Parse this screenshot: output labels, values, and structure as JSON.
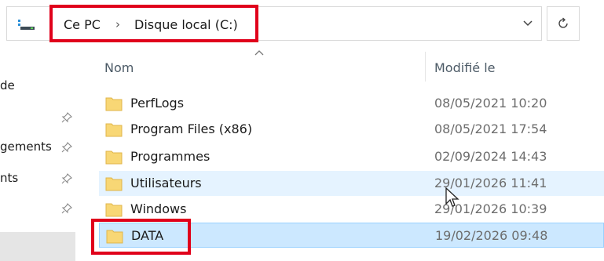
{
  "address_bar": {
    "breadcrumb": [
      {
        "label": "Ce PC"
      },
      {
        "label": "Disque local (C:)"
      }
    ],
    "separator": "›",
    "icon": "this-pc-icon",
    "dropdown_icon": "chevron-down-icon",
    "refresh_icon": "refresh-icon"
  },
  "nav_pane": {
    "items": [
      {
        "label": "de",
        "pinned": false
      },
      {
        "label": "",
        "pinned": true
      },
      {
        "label": "gements",
        "pinned": true
      },
      {
        "label": "nts",
        "pinned": true
      },
      {
        "label": "",
        "pinned": true
      }
    ]
  },
  "columns": {
    "name": "Nom",
    "modified": "Modifié le",
    "sort_icon": "sort-ascending-icon"
  },
  "files": [
    {
      "name": "PerfLogs",
      "modified": "08/05/2021 10:20",
      "state": "normal"
    },
    {
      "name": "Program Files (x86)",
      "modified": "08/05/2021 17:54",
      "state": "normal"
    },
    {
      "name": "Programmes",
      "modified": "02/09/2024 14:43",
      "state": "normal"
    },
    {
      "name": "Utilisateurs",
      "modified": "29/01/2026 11:41",
      "state": "hover"
    },
    {
      "name": "Windows",
      "modified": "29/01/2026 10:39",
      "state": "normal"
    },
    {
      "name": "DATA",
      "modified": "19/02/2026 09:48",
      "state": "selected"
    }
  ],
  "colors": {
    "highlight_red": "#e0001b",
    "selection_bg": "#cce8ff",
    "hover_bg": "#e5f3ff",
    "folder_yellow": "#f8d775"
  }
}
